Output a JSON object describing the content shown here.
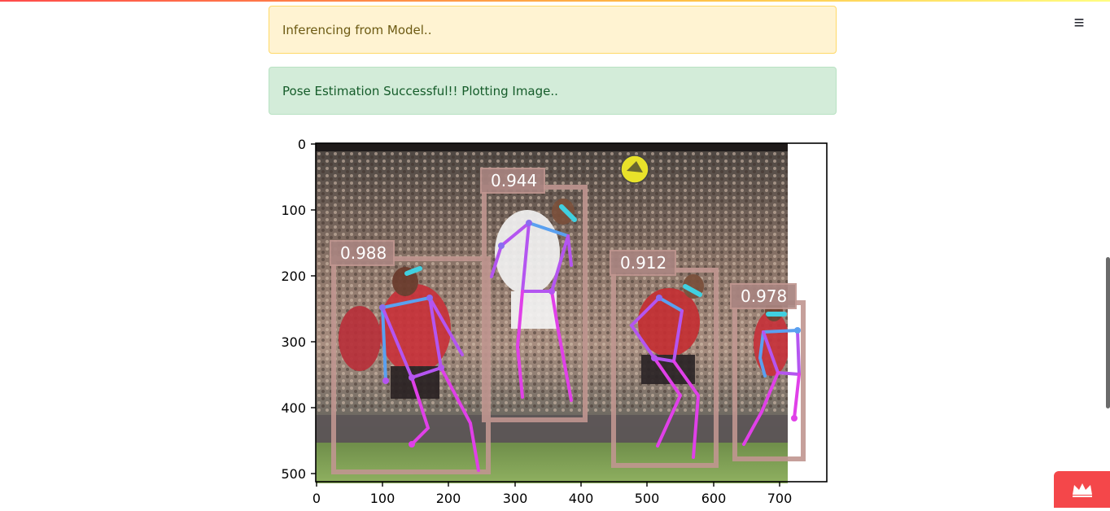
{
  "alerts": {
    "warning_text": "Inferencing from Model..",
    "success_text": "Pose Estimation Successful!! Plotting Image.."
  },
  "menu": {
    "icon": "hamburger-menu-icon",
    "glyph": "≡"
  },
  "figure": {
    "x_ticks": [
      "0",
      "100",
      "200",
      "300",
      "400",
      "500",
      "600",
      "700"
    ],
    "y_ticks": [
      "0",
      "100",
      "200",
      "300",
      "400",
      "500"
    ],
    "detections": [
      {
        "score": "0.988"
      },
      {
        "score": "0.944"
      },
      {
        "score": "0.912"
      },
      {
        "score": "0.978"
      }
    ],
    "box_color": "#c09690",
    "skeleton_colors": [
      "#b455f0",
      "#e040e8",
      "#5aa0f0",
      "#40d0e0"
    ]
  },
  "deploy": {
    "icon": "crown-icon"
  }
}
